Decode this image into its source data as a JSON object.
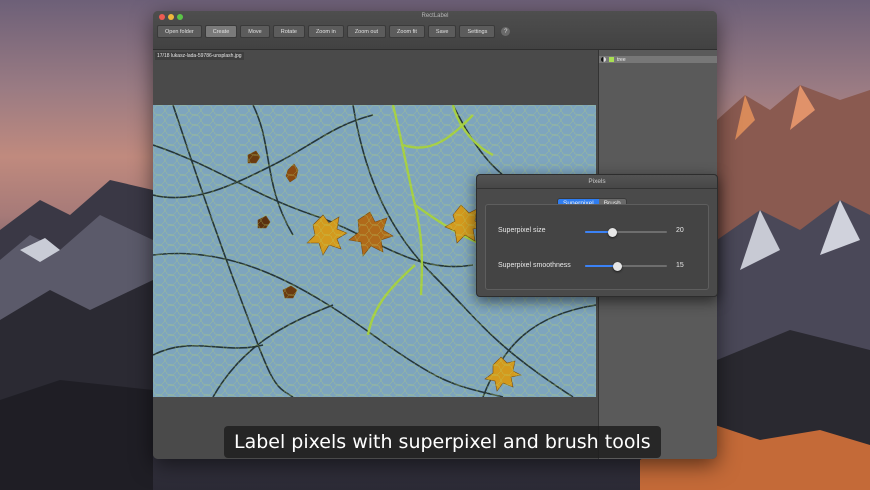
{
  "window": {
    "title": "RectLabel"
  },
  "toolbar": {
    "buttons": [
      "Open folder",
      "Create",
      "Move",
      "Rotate",
      "Zoom in",
      "Zoom out",
      "Zoom fit",
      "Save",
      "Settings"
    ],
    "active_index": 1,
    "help_label": "?"
  },
  "image": {
    "filename": "17/18 lukasz-lada-59786-unsplash.jpg"
  },
  "labels": [
    {
      "name": "tree",
      "color": "#a9e052"
    }
  ],
  "panel": {
    "title": "Pixels",
    "tabs": [
      "Superpixel",
      "Brush"
    ],
    "active_tab": "Superpixel",
    "superpixel_size": {
      "label": "Superpixel size",
      "value": "20",
      "fraction": 0.34
    },
    "superpixel_smoothness": {
      "label": "Superpixel smoothness",
      "value": "15",
      "fraction": 0.4
    }
  },
  "caption": "Label pixels with superpixel and brush tools",
  "icons": {
    "contrast": "contrast-icon",
    "help": "help-icon"
  }
}
